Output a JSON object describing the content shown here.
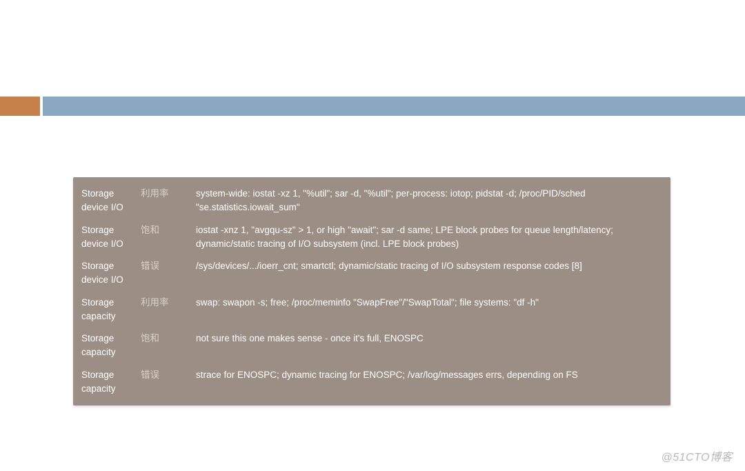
{
  "rows": [
    {
      "component": "Storage device I/O",
      "type": "利用率",
      "desc": "system-wide: iostat -xz 1, \"%util\"; sar -d, \"%util\"; per-process: iotop; pidstat -d; /proc/PID/sched \"se.statistics.iowait_sum\""
    },
    {
      "component": "Storage device I/O",
      "type": "饱和",
      "desc": "iostat -xnz 1, \"avgqu-sz\" > 1, or high \"await\"; sar -d same; LPE block probes for queue length/latency; dynamic/static tracing of I/O subsystem (incl. LPE block probes)"
    },
    {
      "component": "Storage device I/O",
      "type": "错误",
      "desc": "/sys/devices/.../ioerr_cnt; smartctl; dynamic/static tracing of I/O subsystem response codes [8]"
    },
    {
      "component": "Storage capacity",
      "type": "利用率",
      "desc": "swap: swapon -s; free; /proc/meminfo \"SwapFree\"/\"SwapTotal\"; file systems: \"df -h\""
    },
    {
      "component": "Storage capacity",
      "type": "饱和",
      "desc": "not sure this one makes sense - once it's full, ENOSPC"
    },
    {
      "component": "Storage capacity",
      "type": "错误",
      "desc": "strace for ENOSPC; dynamic tracing for ENOSPC; /var/log/messages errs, depending on FS"
    }
  ],
  "watermark": "@51CTO博客"
}
